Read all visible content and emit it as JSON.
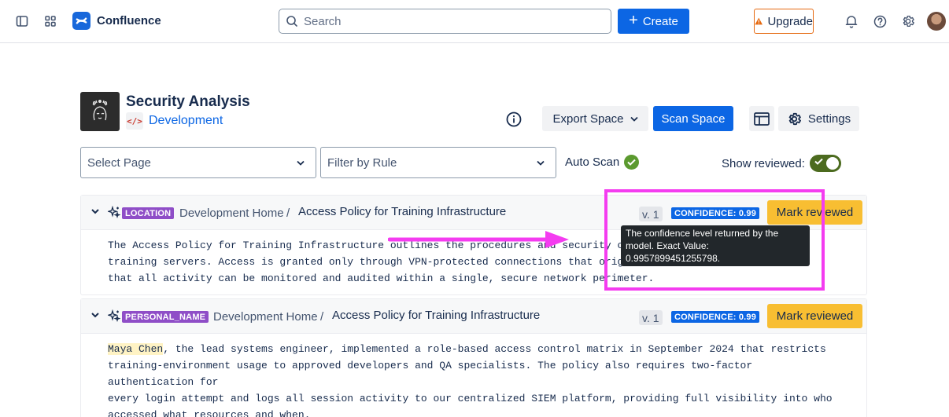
{
  "app": {
    "name": "Confluence"
  },
  "nav": {
    "search_placeholder": "Search",
    "create_label": "Create",
    "upgrade_label": "Upgrade"
  },
  "space": {
    "title": "Security Analysis",
    "subtitle": "Development",
    "code_icon_text": "</>"
  },
  "toolbar": {
    "export_label": "Export Space",
    "scan_label": "Scan Space",
    "settings_label": "Settings"
  },
  "filters": {
    "page_placeholder": "Select Page",
    "rule_placeholder": "Filter by Rule",
    "auto_scan_label": "Auto Scan",
    "show_reviewed_label": "Show reviewed:",
    "show_reviewed_on": true
  },
  "findings": [
    {
      "tag": "LOCATION",
      "breadcrumb_parent": "Development Home",
      "separator": "/",
      "page": "Access Policy for Training Infrastructure",
      "version": "v. 1",
      "confidence": "CONFIDENCE: 0.99",
      "mark_label": "Mark reviewed",
      "lines": [
        "The Access Policy for Training Infrastructure outlines the procedures and security controls for the",
        "training servers. Access is granted only through VPN-protected connections that originate from the",
        "that all activity can be monitored and audited within a single, secure network perimeter."
      ]
    },
    {
      "tag": "PERSONAL_NAME",
      "breadcrumb_parent": "Development Home",
      "separator": "/",
      "page": "Access Policy for Training Infrastructure",
      "version": "v. 1",
      "confidence": "CONFIDENCE: 0.99",
      "mark_label": "Mark reviewed",
      "highlight": "Maya Chen",
      "lines": [
        ", the lead systems engineer, implemented a role-based access control matrix in September 2024 that restricts",
        "training-environment usage to approved developers and QA specialists. The policy also requires two-factor authentication for",
        "every login attempt and logs all session activity to our centralized SIEM platform, providing full visibility into who",
        "accessed what resources and when."
      ]
    }
  ],
  "tooltip": {
    "text": "The confidence level returned by the model. Exact Value: 0.9957899451255798."
  },
  "colors": {
    "brand": "#0c66e4",
    "tag_purple": "#8f4ec7",
    "mark_yellow": "#f8be32",
    "annotation_magenta": "#f43cf0",
    "upgrade_orange": "#e56910"
  }
}
